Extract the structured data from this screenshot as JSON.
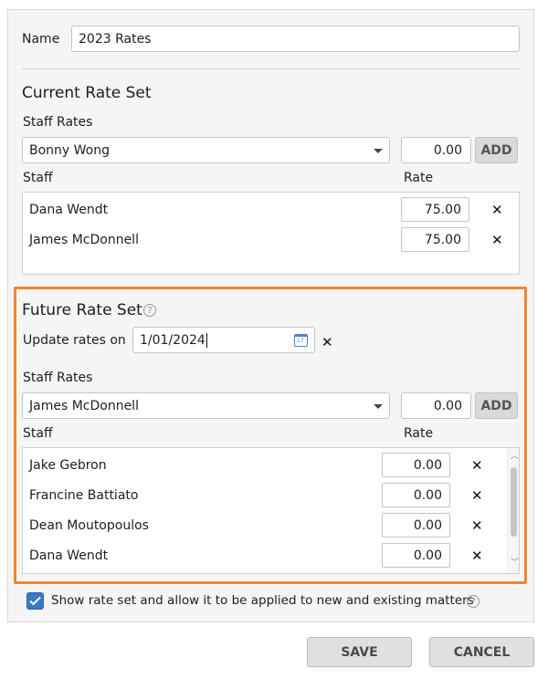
{
  "name": {
    "label": "Name",
    "value": "2023 Rates"
  },
  "current": {
    "title": "Current Rate Set",
    "staff_rates_label": "Staff Rates",
    "staff_select_value": "Bonny Wong",
    "rate_value": "0.00",
    "add_label": "ADD",
    "col_staff": "Staff",
    "col_rate": "Rate",
    "rows": [
      {
        "name": "Dana Wendt",
        "rate": "75.00"
      },
      {
        "name": "James McDonnell",
        "rate": "75.00"
      }
    ]
  },
  "future": {
    "title": "Future Rate Set",
    "update_label": "Update rates on",
    "date_value": "1/01/2024",
    "staff_rates_label": "Staff Rates",
    "staff_select_value": "James McDonnell",
    "rate_value": "0.00",
    "add_label": "ADD",
    "col_staff": "Staff",
    "col_rate": "Rate",
    "rows": [
      {
        "name": "Jake Gebron",
        "rate": "0.00"
      },
      {
        "name": "Francine Battiato",
        "rate": "0.00"
      },
      {
        "name": "Dean Moutopoulos",
        "rate": "0.00"
      },
      {
        "name": "Dana Wendt",
        "rate": "0.00"
      }
    ]
  },
  "show_rate_set": {
    "label": "Show rate set and allow it to be applied to new and existing matters",
    "checked": true
  },
  "footer": {
    "save_label": "SAVE",
    "cancel_label": "CANCEL"
  },
  "colors": {
    "accent_border": "#ef8433",
    "checkbox": "#3a78c3"
  },
  "icons": {
    "remove": "close-icon",
    "help": "help-icon",
    "calendar": "calendar-icon",
    "dropdown": "chevron-down-icon"
  }
}
